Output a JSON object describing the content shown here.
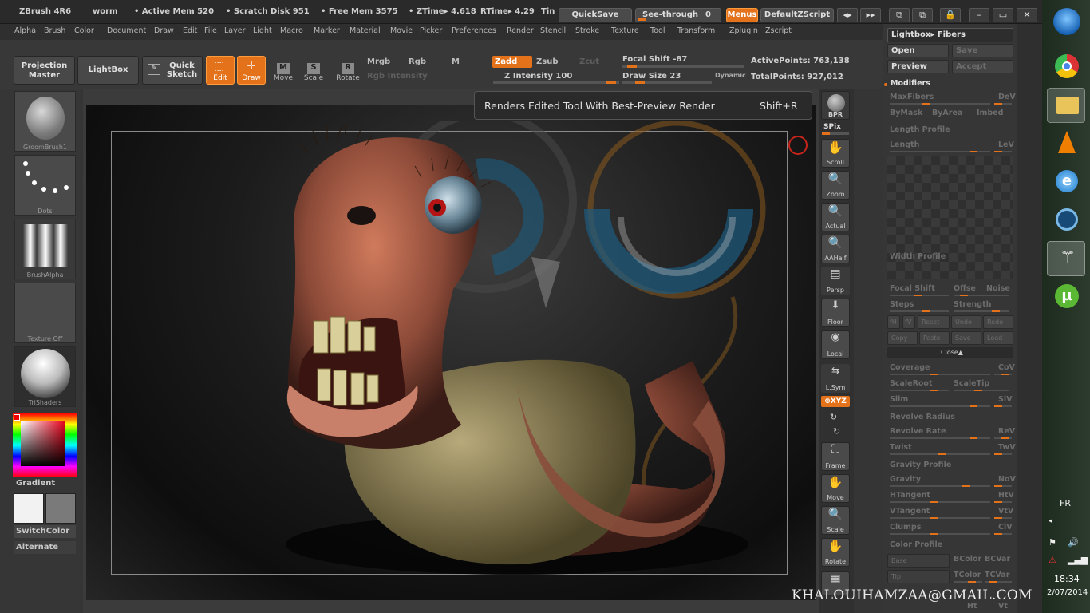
{
  "titlebar": {
    "app": "ZBrush 4R6",
    "doc": "worm",
    "active_mem": "• Active Mem 520",
    "scratch": "• Scratch Disk 951",
    "free_mem": "• Free Mem 3575",
    "ztime": "• ZTime▸ 4.618",
    "rtime": "RTime▸ 4.29",
    "timer": "Tin",
    "quicksave": "QuickSave",
    "seethrough": "See-through",
    "seethrough_value": "0",
    "menus": "Menus",
    "zscript": "DefaultZScript"
  },
  "menubar": [
    "Alpha",
    "Brush",
    "Color",
    "Document",
    "Draw",
    "Edit",
    "File",
    "Layer",
    "Light",
    "Macro",
    "Marker",
    "Material",
    "Movie",
    "Picker",
    "Preferences",
    "Render",
    "Stencil",
    "Stroke",
    "Texture",
    "Tool",
    "Transform",
    "Zplugin",
    "Zscript"
  ],
  "toolbar": {
    "projection_master": "Projection Master",
    "lightbox": "LightBox",
    "quick_sketch": "Quick Sketch",
    "edit": "Edit",
    "draw": "Draw",
    "move": "Move",
    "scale": "Scale",
    "rotate": "Rotate",
    "mrgb": "Mrgb",
    "rgb": "Rgb",
    "m": "M",
    "zadd": "Zadd",
    "zsub": "Zsub",
    "zcut": "Zcut",
    "rgb_intensity": "Rgb Intensity",
    "z_intensity": "Z Intensity 100",
    "focal_shift": "Focal Shift -87",
    "draw_size": "Draw Size 23",
    "dynamic": "Dynamic",
    "active_points": "ActivePoints: 763,138",
    "total_points": "TotalPoints: 927,012"
  },
  "lefttray": {
    "brush": "GroomBrush1",
    "stroke": "Dots",
    "alpha": "BrushAlpha",
    "texture": "Texture Off",
    "material": "TriShaders",
    "gradient": "Gradient",
    "switchcolor": "SwitchColor",
    "alternate": "Alternate"
  },
  "tooltip": {
    "text": "Renders Edited Tool With Best-Preview Render",
    "shortcut": "Shift+R"
  },
  "watermark": "KHALOUIHAMZAA@GMAIL.COM",
  "shelf": {
    "bpr": "BPR",
    "spix": "SPix",
    "scroll": "Scroll",
    "zoom": "Zoom",
    "actual": "Actual",
    "aahalf": "AAHalf",
    "persp": "Persp",
    "floor": "Floor",
    "local": "Local",
    "lsym": "L.Sym",
    "xyz": "⊕XYZ",
    "frame": "Frame",
    "move": "Move",
    "scale": "Scale",
    "rotate": "Rotate"
  },
  "rpanel": {
    "title": "Lightbox▸ Fibers",
    "open": "Open",
    "save": "Save",
    "preview": "Preview",
    "accept": "Accept",
    "modifiers": "Modifiers",
    "maxfibers": "MaxFibers",
    "dev": "DeV",
    "bymask": "ByMask",
    "byarea": "ByArea",
    "imbed": "Imbed",
    "length_profile": "Length Profile",
    "length": "Length",
    "lev": "LeV",
    "width_profile": "Width Profile",
    "focal_shift": "Focal Shift",
    "offset": "Offse",
    "noise": "Noise",
    "steps": "Steps",
    "strength": "Strength",
    "fh": "fH",
    "fv": "fV",
    "reset": "Reset",
    "undo": "Undo",
    "redo": "Redo",
    "copy": "Copy",
    "paste": "Paste",
    "psave": "Save",
    "load": "Load",
    "close": "Close▲",
    "coverage": "Coverage",
    "cov": "CoV",
    "scaleroot": "ScaleRoot",
    "scaletip": "ScaleTip",
    "slim": "Slim",
    "slv": "SlV",
    "revolve_radius": "Revolve Radius",
    "revolve_rate": "Revolve Rate",
    "rev": "ReV",
    "twist": "Twist",
    "twv": "TwV",
    "gravity_profile": "Gravity Profile",
    "gravity": "Gravity",
    "nov": "NoV",
    "htangent": "HTangent",
    "htv": "HtV",
    "vtangent": "VTangent",
    "vtv": "VtV",
    "clumps": "Clumps",
    "clv": "ClV",
    "color_profile": "Color Profile",
    "base": "Base",
    "bcolor": "BColor",
    "bcvar": "BCVar",
    "tip": "Tip",
    "tcolor": "TColor",
    "tcvar": "TCVar",
    "ht": "Ht",
    "vt": "Vt"
  },
  "systray": {
    "lang": "FR",
    "time": "18:34",
    "date": "2/07/2014"
  },
  "colors": {
    "accent": "#e4721a",
    "panel": "#363636",
    "canvas": "#3b3b3b"
  }
}
